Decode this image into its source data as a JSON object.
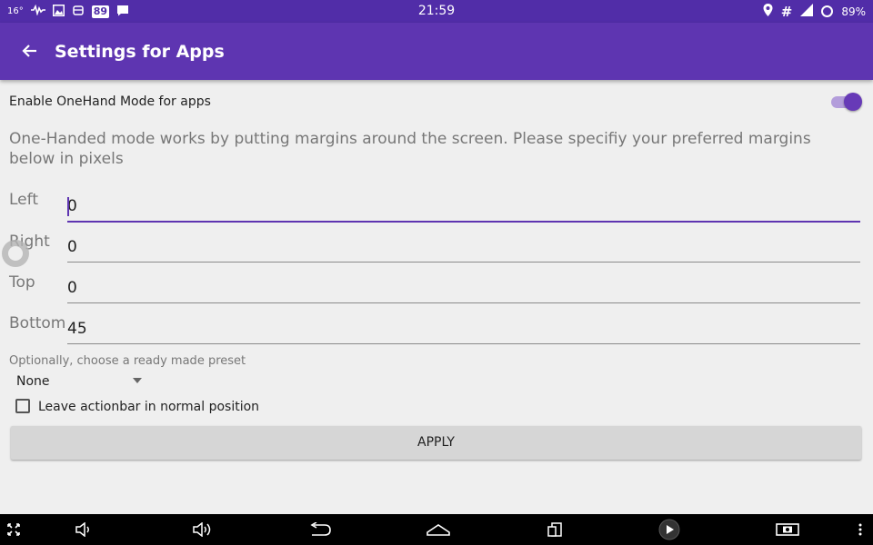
{
  "status_bar": {
    "temperature": "16°",
    "notification_badge": "89",
    "time": "21:59",
    "battery": "89%",
    "icons_left": [
      "temperature-icon",
      "activity-icon",
      "image-icon",
      "android-icon",
      "badge-icon",
      "message-icon"
    ],
    "icons_right": [
      "location-icon",
      "hash-icon",
      "signal-icon",
      "battery-ring-icon"
    ]
  },
  "toolbar": {
    "title": "Settings for Apps",
    "back_icon": "arrow-back-icon"
  },
  "enable": {
    "label": "Enable OneHand Mode for apps",
    "on": true
  },
  "description": "One-Handed mode works by putting margins around the screen. Please specifiy your preferred margins below in pixels",
  "margins": [
    {
      "label": "Left",
      "value": "0"
    },
    {
      "label": "Right",
      "value": "0"
    },
    {
      "label": "Top",
      "value": "0"
    },
    {
      "label": "Bottom",
      "value": "45"
    }
  ],
  "preset": {
    "hint": "Optionally, choose a ready made preset",
    "selected": "None"
  },
  "actionbar": {
    "label": "Leave actionbar in normal position",
    "checked": false
  },
  "apply_label": "APPLY",
  "nav_bar": {
    "buttons": [
      "fullscreen-icon",
      "volume-down-icon",
      "volume-up-icon",
      "back-icon",
      "home-icon",
      "recent-apps-icon",
      "play-icon",
      "screenshot-icon",
      "menu-icon"
    ]
  },
  "colors": {
    "status_bar": "#512da8",
    "toolbar": "#5e35b1",
    "accent": "#673ab7",
    "background": "#efefef"
  }
}
